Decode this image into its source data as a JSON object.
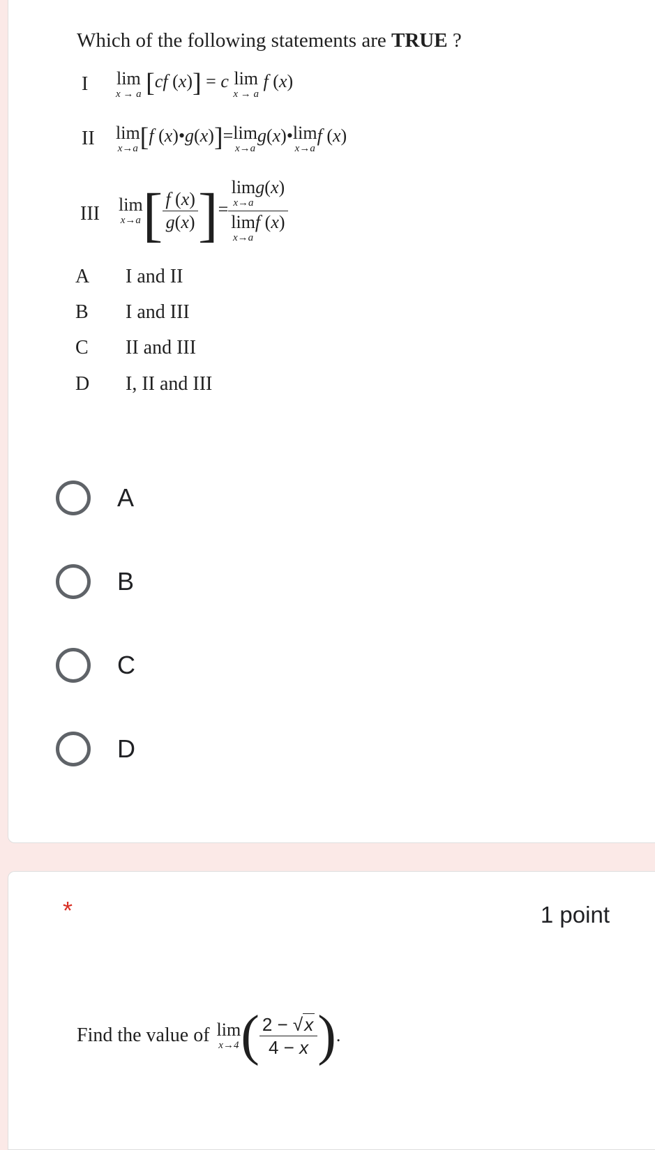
{
  "question1": {
    "title_prefix": "Which of the following statements are ",
    "title_bold": "TRUE",
    "title_suffix": " ?",
    "statements": [
      {
        "numeral": "I"
      },
      {
        "numeral": "II"
      },
      {
        "numeral": "III"
      }
    ],
    "answer_choices": [
      {
        "letter": "A",
        "text": "I and II"
      },
      {
        "letter": "B",
        "text": "I and III"
      },
      {
        "letter": "C",
        "text": "II and III"
      },
      {
        "letter": "D",
        "text": "I, II and III"
      }
    ],
    "radio_options": [
      "A",
      "B",
      "C",
      "D"
    ]
  },
  "question2": {
    "required_mark": "*",
    "points": "1 point",
    "prompt": "Find the value of"
  },
  "colors": {
    "page_background": "#fbe9e7",
    "card_background": "#ffffff",
    "radio_border": "#5f6368",
    "required": "#d93025"
  }
}
